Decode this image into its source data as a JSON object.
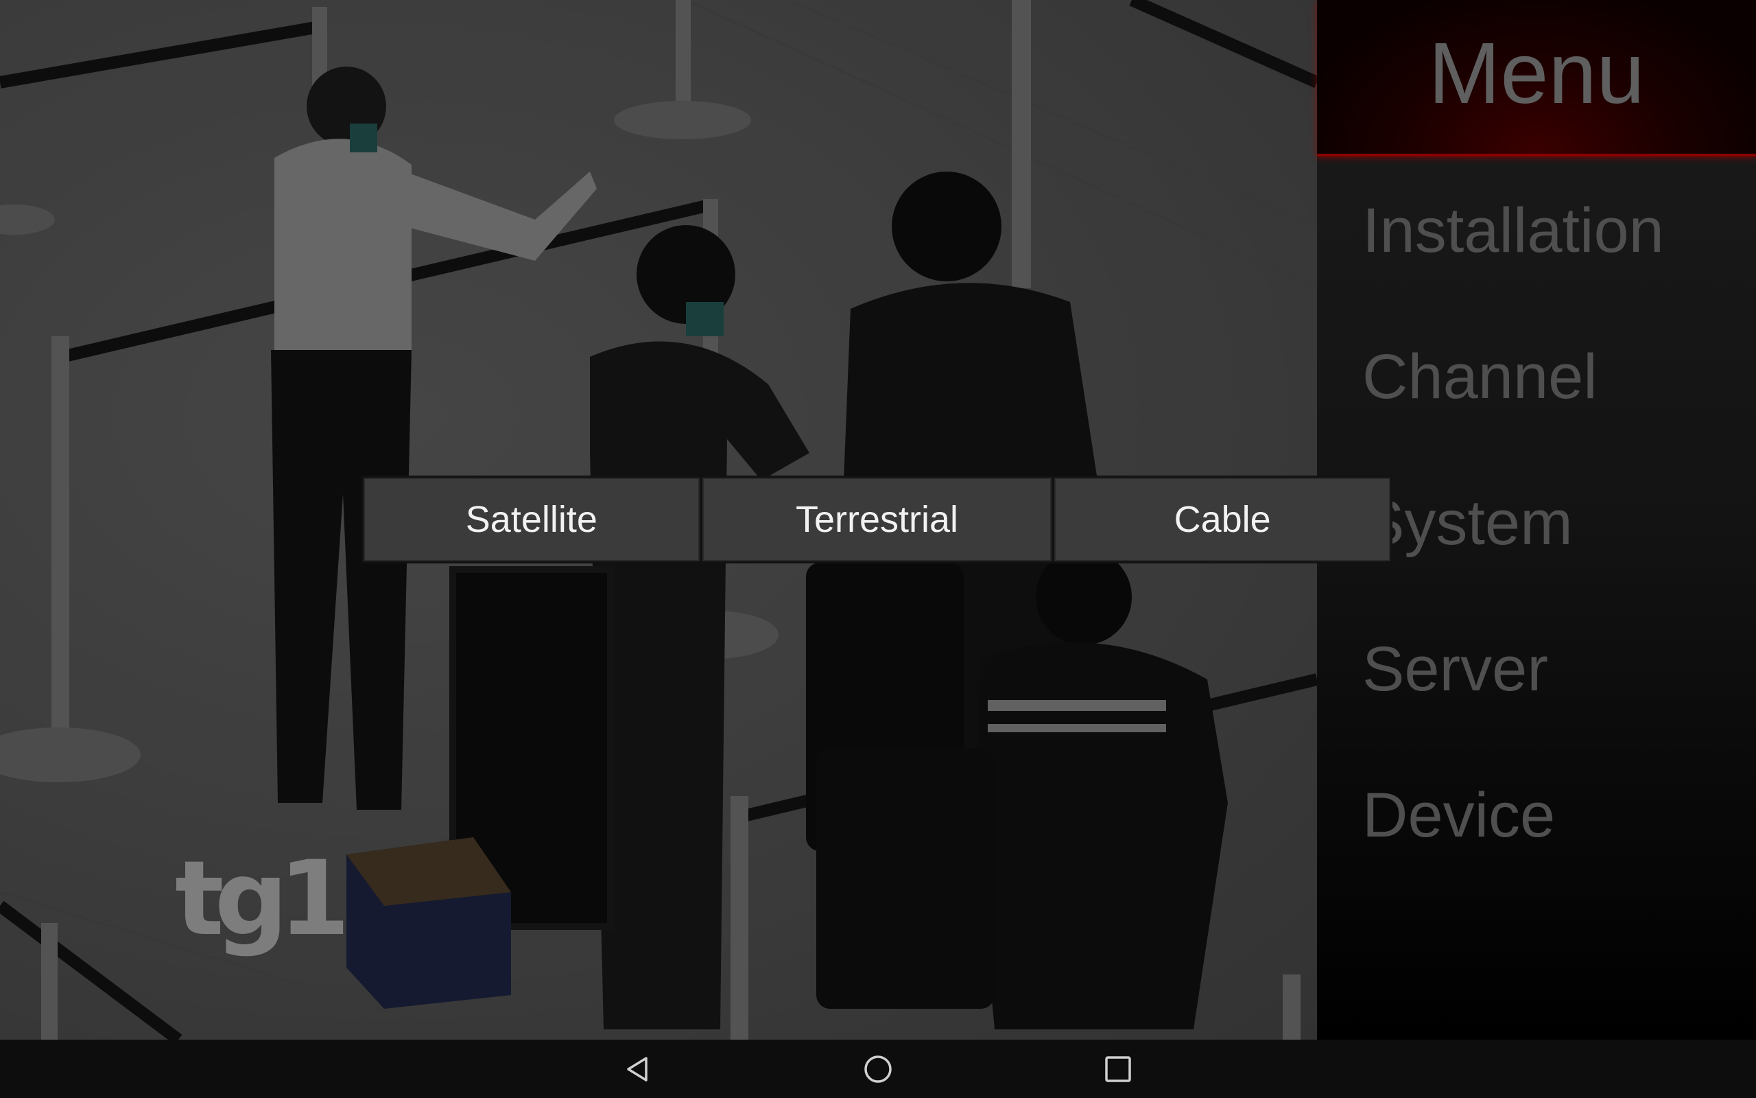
{
  "menu": {
    "title": "Menu",
    "items": [
      {
        "label": "Installation"
      },
      {
        "label": "Channel"
      },
      {
        "label": "System"
      },
      {
        "label": "Server"
      },
      {
        "label": "Device"
      }
    ]
  },
  "source_dialog": {
    "options": [
      {
        "label": "Satellite"
      },
      {
        "label": "Terrestrial"
      },
      {
        "label": "Cable"
      }
    ]
  },
  "video": {
    "channel_logo": "tg1"
  },
  "nav_bar": {
    "icons": [
      "back-icon",
      "home-icon",
      "recents-icon"
    ]
  },
  "colors": {
    "accent_red": "#8b0000",
    "button_bg": "#3b3b3b",
    "menu_text": "#4f4f4f"
  }
}
